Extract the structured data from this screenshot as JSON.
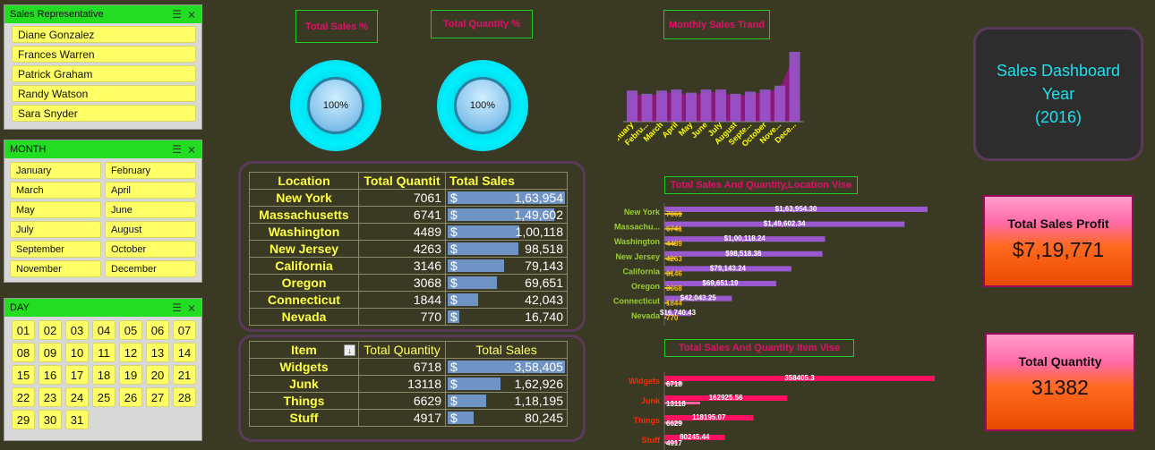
{
  "slicers": {
    "rep": {
      "title": "Sales Representative",
      "items": [
        "Diane Gonzalez",
        "Frances Warren",
        "Patrick Graham",
        "Randy Watson",
        "Sara Snyder"
      ]
    },
    "month": {
      "title": "MONTH",
      "items": [
        "January",
        "February",
        "March",
        "April",
        "May",
        "June",
        "July",
        "August",
        "September",
        "October",
        "November",
        "December"
      ]
    },
    "day": {
      "title": "DAY",
      "items": [
        "01",
        "02",
        "03",
        "04",
        "05",
        "06",
        "07",
        "08",
        "09",
        "10",
        "11",
        "12",
        "13",
        "14",
        "15",
        "16",
        "17",
        "18",
        "19",
        "20",
        "21",
        "22",
        "23",
        "24",
        "25",
        "26",
        "27",
        "28",
        "29",
        "30",
        "31"
      ]
    }
  },
  "headers": {
    "total_sales_pct": "Total Sales %",
    "total_qty_pct": "Total Quantity %",
    "monthly_trend": "Monthly Sales Trand",
    "loc_chart": "Total Sales And Quantity,Location Vise",
    "item_chart": "Total Sales And Quantity Item Vise"
  },
  "gauges": {
    "sales": "100%",
    "qty": "100%"
  },
  "location_table": {
    "columns": [
      "Location",
      "Total Quantit",
      "Total Sales"
    ],
    "rows": [
      {
        "name": "New York",
        "qty": "7061",
        "sales": "1,63,954",
        "frac": 1.0
      },
      {
        "name": "Massachusetts",
        "qty": "6741",
        "sales": "1,49,602",
        "frac": 0.91
      },
      {
        "name": "Washington",
        "qty": "4489",
        "sales": "1,00,118",
        "frac": 0.61
      },
      {
        "name": "New Jersey",
        "qty": "4263",
        "sales": "98,518",
        "frac": 0.6
      },
      {
        "name": "California",
        "qty": "3146",
        "sales": "79,143",
        "frac": 0.48
      },
      {
        "name": "Oregon",
        "qty": "3068",
        "sales": "69,651",
        "frac": 0.42
      },
      {
        "name": "Connecticut",
        "qty": "1844",
        "sales": "42,043",
        "frac": 0.26
      },
      {
        "name": "Nevada",
        "qty": "770",
        "sales": "16,740",
        "frac": 0.1
      }
    ]
  },
  "item_table": {
    "columns": [
      "Item",
      "Total Quantity",
      "Total Sales"
    ],
    "rows": [
      {
        "name": "Widgets",
        "qty": "6718",
        "sales": "3,58,405",
        "frac": 1.0
      },
      {
        "name": "Junk",
        "qty": "13118",
        "sales": "1,62,926",
        "frac": 0.45
      },
      {
        "name": "Things",
        "qty": "6629",
        "sales": "1,18,195",
        "frac": 0.33
      },
      {
        "name": "Stuff",
        "qty": "4917",
        "sales": "80,245",
        "frac": 0.22
      }
    ]
  },
  "currency_symbol": "$",
  "dashboard": {
    "line1": "Sales Dashboard",
    "line2": "Year",
    "line3": "(2016)"
  },
  "kpis": {
    "profit_label": "Total Sales Profit",
    "profit_value": "$7,19,771",
    "qty_label": "Total Quantity",
    "qty_value": "31382"
  },
  "chart_data": [
    {
      "type": "bar",
      "title": "Monthly Sales Trand",
      "categories": [
        "January",
        "Febru...",
        "March",
        "April",
        "May",
        "June",
        "July",
        "August",
        "Septe...",
        "October",
        "Nove...",
        "Dece..."
      ],
      "values": [
        58000,
        52000,
        58000,
        60000,
        54000,
        60000,
        60000,
        52000,
        56000,
        60000,
        67000,
        130000
      ],
      "ylim": [
        0,
        140000
      ],
      "series_color": "#9b59d0",
      "area_color": "#8a1a7a"
    },
    {
      "type": "bar",
      "title": "Total Sales And Quantity,Location Vise",
      "categories": [
        "New York",
        "Massachu...",
        "Washington",
        "New Jersey",
        "California",
        "Oregon",
        "Connecticut",
        "Nevada"
      ],
      "series": [
        {
          "values": [
            163954.3,
            149602.34,
            100118.24,
            98518.38,
            79143.24,
            69651.19,
            42043.25,
            16740.43
          ],
          "labels": [
            "$1,63,954.30",
            "$1,49,602.34",
            "$1,00,118.24",
            "$98,518.38",
            "$79,143.24",
            "$69,651.19",
            "$42,043.25",
            "$16,740.43"
          ],
          "color": "#9b59d0"
        },
        {
          "values": [
            7061,
            6741,
            4489,
            4263,
            3146,
            3068,
            1844,
            770
          ],
          "labels": [
            "7061",
            "6741",
            "4489",
            "4263",
            "3146",
            "3068",
            "1844",
            "770"
          ],
          "color": "#f0c020"
        }
      ],
      "category_color": "#9acd32"
    },
    {
      "type": "bar",
      "title": "Total Sales And Quantity Item Vise",
      "categories": [
        "Widgets",
        "Junk",
        "Things",
        "Stuff"
      ],
      "series": [
        {
          "values": [
            358405.3,
            162925.56,
            118195.07,
            80245.44
          ],
          "labels": [
            "358405.3",
            "162925.56",
            "118195.07",
            "80245.44"
          ],
          "color": "#ff1060"
        },
        {
          "values": [
            6718,
            13118,
            6629,
            4917
          ],
          "labels": [
            "6718",
            "13118",
            "6629",
            "4917"
          ],
          "color": "#ff60a0"
        }
      ],
      "category_color": "#ff2a00"
    }
  ]
}
